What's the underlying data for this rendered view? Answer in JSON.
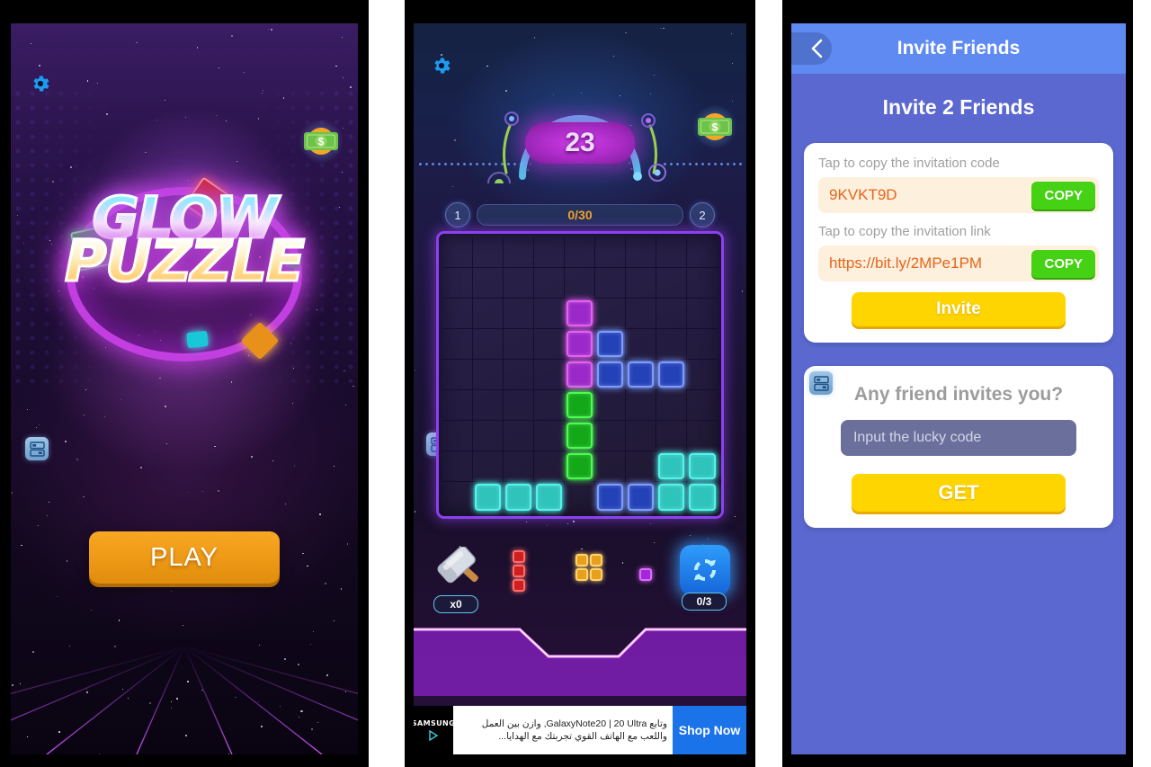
{
  "app": {
    "name": "Glow Puzzle"
  },
  "colors": {
    "accent_purple": "#c23ee0",
    "play_orange": "#ef9b18",
    "nav_blue": "#5f8af2",
    "page_blue": "#5b68d0",
    "copy_green": "#45d114",
    "yellow": "#ffd500",
    "code_orange": "#e8641b",
    "progress_orange": "#f0a429"
  },
  "splash": {
    "logo_line1": "GLOW",
    "logo_line2": "PUZZLE",
    "play_label": "PLAY",
    "icons": {
      "settings": "gear-icon",
      "cash": "cash-icon",
      "widget": "floating-widget-icon"
    }
  },
  "game": {
    "score": "23",
    "level_left": "1",
    "level_right": "2",
    "progress": "0/30",
    "hammer_count": "x0",
    "refresh_count": "0/3",
    "icons": {
      "settings": "gear-icon",
      "cash": "cash-icon",
      "widget": "floating-widget-icon",
      "hammer": "hammer-icon",
      "refresh": "refresh-icon"
    },
    "board": {
      "rows": 9,
      "cols": 9,
      "cells": [
        {
          "r": 2,
          "c": 4,
          "color": "#9b28c8",
          "glow": "#e85ff5"
        },
        {
          "r": 3,
          "c": 4,
          "color": "#9b28c8",
          "glow": "#e85ff5"
        },
        {
          "r": 3,
          "c": 5,
          "color": "#2442b8",
          "glow": "#7b9dff"
        },
        {
          "r": 4,
          "c": 4,
          "color": "#9b28c8",
          "glow": "#e85ff5"
        },
        {
          "r": 4,
          "c": 5,
          "color": "#2442b8",
          "glow": "#7b9dff"
        },
        {
          "r": 4,
          "c": 6,
          "color": "#2442b8",
          "glow": "#7b9dff"
        },
        {
          "r": 4,
          "c": 7,
          "color": "#2442b8",
          "glow": "#7b9dff"
        },
        {
          "r": 5,
          "c": 4,
          "color": "#12a818",
          "glow": "#49ff4e"
        },
        {
          "r": 6,
          "c": 4,
          "color": "#12a818",
          "glow": "#49ff4e"
        },
        {
          "r": 7,
          "c": 4,
          "color": "#12a818",
          "glow": "#49ff4e"
        },
        {
          "r": 7,
          "c": 7,
          "color": "#2ec4bc",
          "glow": "#4ff5ec"
        },
        {
          "r": 7,
          "c": 8,
          "color": "#2ec4bc",
          "glow": "#4ff5ec"
        },
        {
          "r": 8,
          "c": 1,
          "color": "#2ec4bc",
          "glow": "#4ff5ec"
        },
        {
          "r": 8,
          "c": 2,
          "color": "#2ec4bc",
          "glow": "#4ff5ec"
        },
        {
          "r": 8,
          "c": 3,
          "color": "#2ec4bc",
          "glow": "#4ff5ec"
        },
        {
          "r": 8,
          "c": 5,
          "color": "#2442b8",
          "glow": "#7b9dff"
        },
        {
          "r": 8,
          "c": 6,
          "color": "#2442b8",
          "glow": "#7b9dff"
        },
        {
          "r": 8,
          "c": 7,
          "color": "#2ec4bc",
          "glow": "#4ff5ec"
        },
        {
          "r": 8,
          "c": 8,
          "color": "#2ec4bc",
          "glow": "#4ff5ec"
        }
      ]
    },
    "tray_pieces": [
      {
        "name": "red-i3-piece",
        "cols": 1,
        "rows": 3,
        "color": "#cf2020",
        "glow": "#ff6b6b"
      },
      {
        "name": "orange-o4-piece",
        "cols": 2,
        "rows": 2,
        "color": "#e8a01c",
        "glow": "#ffd36b"
      },
      {
        "name": "purple-single-piece",
        "cols": 1,
        "rows": 1,
        "color": "#a227d6",
        "glow": "#e06bff"
      }
    ],
    "ad": {
      "brand": "SAMSUNG",
      "text": "وتابع GalaxyNote20 | 20 Ultra, وازن بين العمل واللعب مع الهاتف القوي تجربتك مع الهدايا...",
      "cta": "Shop Now"
    }
  },
  "invite": {
    "nav_title": "Invite Friends",
    "back_icon": "chevron-left-icon",
    "page_title": "Invite 2 Friends",
    "code_label": "Tap to copy the invitation code",
    "code_value": "9KVKT9D",
    "code_copy_label": "COPY",
    "link_label": "Tap to copy the invitation link",
    "link_value": "https://bit.ly/2MPe1PM",
    "link_copy_label": "COPY",
    "invite_button": "Invite",
    "lucky_title": "Any friend invites you?",
    "lucky_placeholder": "Input the lucky code",
    "get_button": "GET",
    "widget_icon": "floating-widget-icon"
  }
}
